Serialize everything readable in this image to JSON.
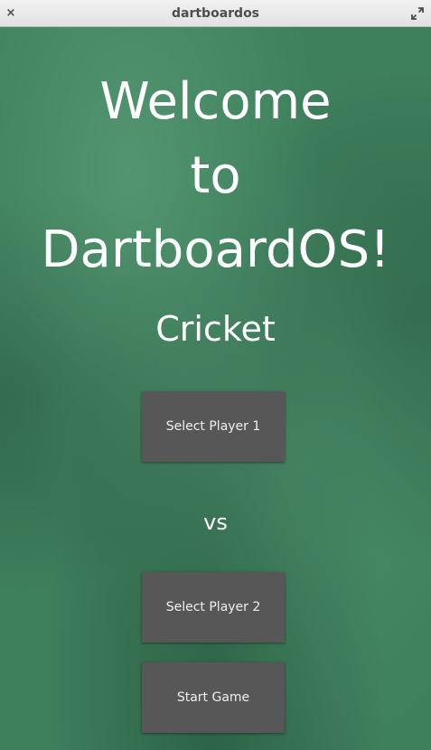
{
  "window": {
    "title": "dartboardos",
    "close_glyph": "×"
  },
  "main": {
    "welcome_lines": [
      "Welcome",
      "to",
      "DartboardOS!"
    ],
    "game_mode": "Cricket",
    "select_player_1": "Select Player 1",
    "vs": "vs",
    "select_player_2": "Select Player 2",
    "start_game": "Start Game"
  },
  "colors": {
    "chalkboard_green": "#3e7f5c",
    "button_gray": "#575757",
    "text_white": "#ffffff",
    "titlebar": "#e8e8e8"
  },
  "icons": {
    "close": "close-icon",
    "maximize": "maximize-icon"
  }
}
